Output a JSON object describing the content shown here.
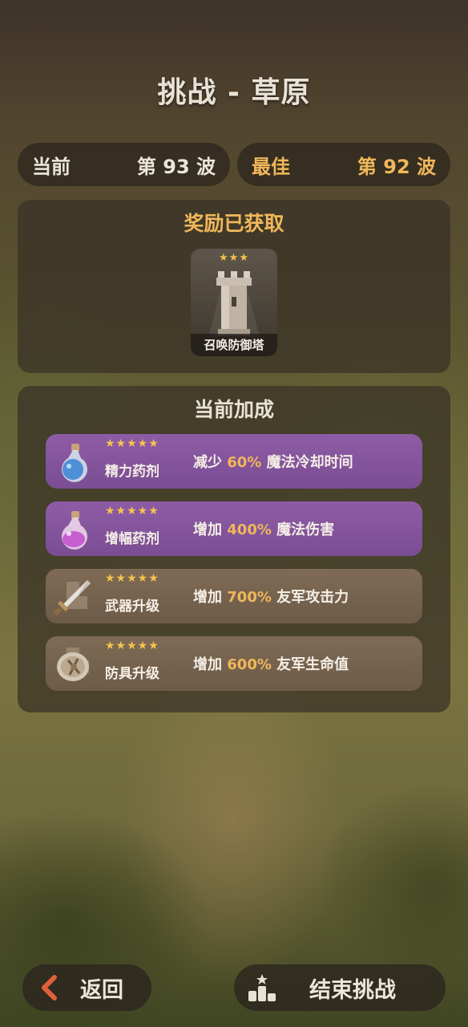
{
  "header": {
    "title": "挑战 - 草原"
  },
  "stats": {
    "current_label": "当前",
    "current_value": "第 93 波",
    "best_label": "最佳",
    "best_value": "第 92 波"
  },
  "reward": {
    "title": "奖励已获取",
    "stars": "★★★",
    "item_label": "召唤防御塔",
    "icon": "tower-icon"
  },
  "bonus": {
    "title": "当前加成",
    "items": [
      {
        "stars": "★★★★★",
        "name": "精力药剂",
        "prefix": "减少 ",
        "percent": "60%",
        "suffix": " 魔法冷却时间",
        "icon": "blue-potion-icon"
      },
      {
        "stars": "★★★★★",
        "name": "增幅药剂",
        "prefix": "增加 ",
        "percent": "400%",
        "suffix": " 魔法伤害",
        "icon": "pink-potion-icon"
      },
      {
        "stars": "★★★★★",
        "name": "武器升级",
        "prefix": "增加 ",
        "percent": "700%",
        "suffix": " 友军攻击力",
        "icon": "sword-icon"
      },
      {
        "stars": "★★★★★",
        "name": "防具升级",
        "prefix": "增加 ",
        "percent": "600%",
        "suffix": " 友军生命值",
        "icon": "shield-icon"
      }
    ]
  },
  "footer": {
    "back_label": "返回",
    "end_label": "结束挑战"
  },
  "colors": {
    "accent_gold": "#f0b75a",
    "purple_row": "#8e5ca6",
    "tan_row": "#7f6b55",
    "back_arrow": "#e0603a"
  }
}
